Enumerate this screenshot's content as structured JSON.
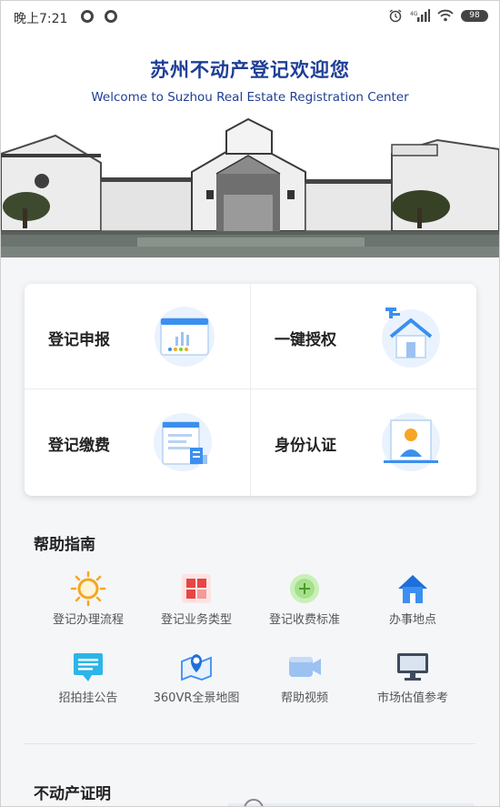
{
  "status_bar": {
    "time": "晚上7:21",
    "battery": "98"
  },
  "hero": {
    "title": "苏州不动产登记欢迎您",
    "subtitle": "Welcome to Suzhou Real Estate Registration Center"
  },
  "services": [
    {
      "label": "登记申报",
      "icon": "report-chart-icon"
    },
    {
      "label": "一键授权",
      "icon": "house-key-icon"
    },
    {
      "label": "登记缴费",
      "icon": "bill-document-icon"
    },
    {
      "label": "身份认证",
      "icon": "person-id-icon"
    }
  ],
  "help": {
    "title": "帮助指南",
    "items": [
      {
        "label": "登记办理流程",
        "icon": "sun-icon"
      },
      {
        "label": "登记业务类型",
        "icon": "grid-icon"
      },
      {
        "label": "登记收费标准",
        "icon": "plus-circle-icon"
      },
      {
        "label": "办事地点",
        "icon": "home-icon"
      },
      {
        "label": "招拍挂公告",
        "icon": "message-icon"
      },
      {
        "label": "360VR全景地图",
        "icon": "map-pin-icon"
      },
      {
        "label": "帮助视频",
        "icon": "video-camera-icon"
      },
      {
        "label": "市场估值参考",
        "icon": "monitor-icon"
      }
    ]
  },
  "certificate_section": {
    "title": "不动产证明"
  },
  "colors": {
    "brand": "#1f3f95",
    "accent_blue": "#3b8ff0",
    "page_bg": "#f5f6f8"
  }
}
